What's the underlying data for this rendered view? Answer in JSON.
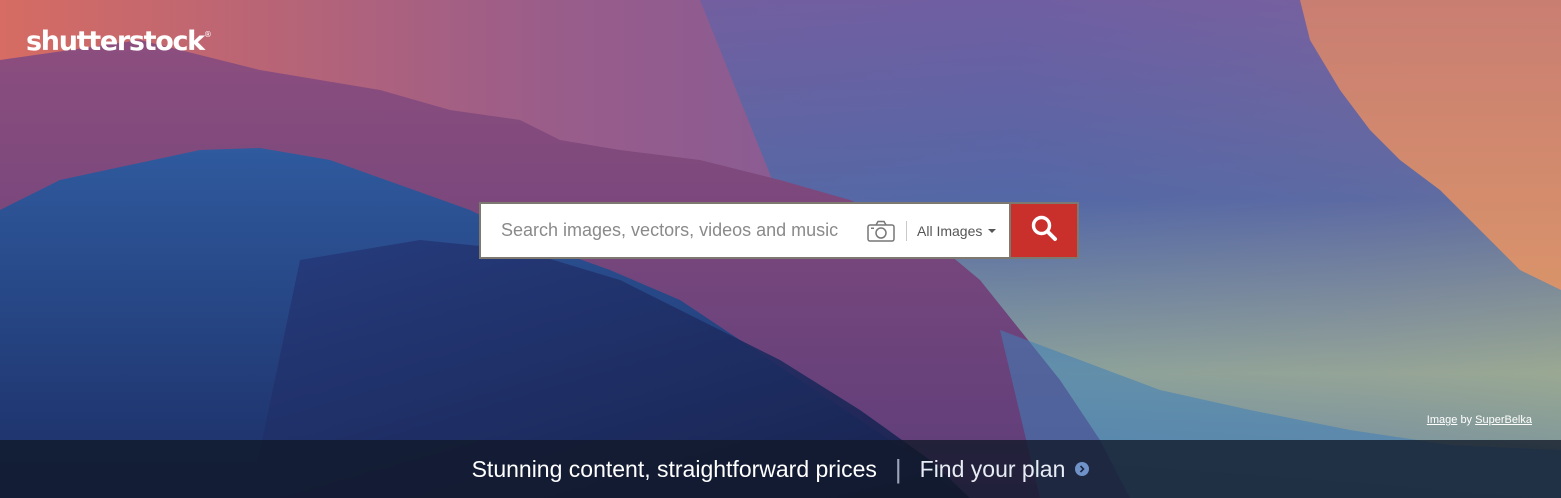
{
  "brand": {
    "name": "shutterstock",
    "reg": "®"
  },
  "search": {
    "placeholder": "Search images, vectors, videos and music",
    "value": "",
    "type_label": "All Images"
  },
  "credit": {
    "image_label": "Image",
    "by": "by",
    "author": "SuperBelka"
  },
  "footer": {
    "tagline": "Stunning content, straightforward prices",
    "separator": "|",
    "plan_link": "Find your plan"
  },
  "colors": {
    "search_button": "#c9302c",
    "footer_bg": "#111828"
  },
  "icons": {
    "camera": "camera-icon",
    "search": "search-icon",
    "caret": "chevron-down-icon",
    "arrow": "arrow-right-circle-icon"
  }
}
